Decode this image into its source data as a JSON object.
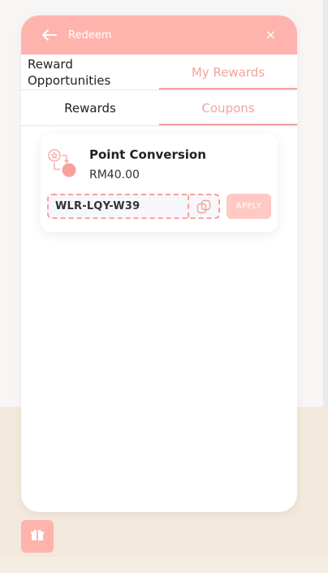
{
  "header": {
    "title": "Redeem",
    "back_icon": "arrow-left-icon",
    "close_icon": "close-icon",
    "close_glyph": "×"
  },
  "tabs": [
    {
      "label": "Reward Opportunities",
      "active": false
    },
    {
      "label": "My Rewards",
      "active": true
    }
  ],
  "subtabs": [
    {
      "label": "Rewards",
      "active": false
    },
    {
      "label": "Coupons",
      "active": true
    }
  ],
  "coupon": {
    "icon": "point-conversion-icon",
    "title": "Point Conversion",
    "amount": "RM40.00",
    "code": "WLR-LQY-W39",
    "copy_icon": "copy-icon",
    "apply_label": "APPLY"
  },
  "launcher": {
    "icon": "gift-icon"
  },
  "colors": {
    "accent": "#ffb3ad",
    "accent_text": "#f3a39c",
    "apply_disabled": "#ffc9c4"
  }
}
